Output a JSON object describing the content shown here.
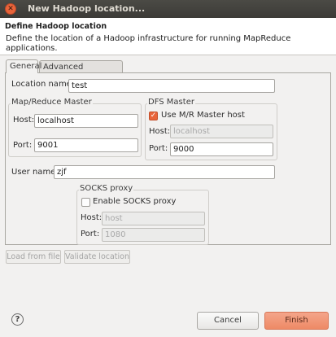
{
  "window": {
    "title": "New Hadoop location..."
  },
  "header": {
    "title": "Define Hadoop location",
    "description": "Define the location of a Hadoop infrastructure for running MapReduce applications."
  },
  "tabs": [
    {
      "label": "General",
      "selected": true
    },
    {
      "label": "Advanced parameters",
      "selected": false
    }
  ],
  "general": {
    "location_name_label": "Location name:",
    "location_name_value": "test",
    "mapreduce_master": {
      "title": "Map/Reduce Master",
      "host_label": "Host:",
      "host_value": "localhost",
      "port_label": "Port:",
      "port_value": "9001"
    },
    "dfs_master": {
      "title": "DFS Master",
      "use_mr_label": "Use M/R Master host",
      "use_mr_checked": true,
      "host_label": "Host:",
      "host_value": "localhost",
      "port_label": "Port:",
      "port_value": "9000"
    },
    "user_name_label": "User name:",
    "user_name_value": "zjf",
    "socks_proxy": {
      "title": "SOCKS proxy",
      "enable_label": "Enable SOCKS proxy",
      "enable_checked": false,
      "host_label": "Host:",
      "host_value": "host",
      "port_label": "Port:",
      "port_value": "1080"
    }
  },
  "actions": {
    "load_from_file": "Load from file",
    "validate_location": "Validate location"
  },
  "footer": {
    "help_glyph": "?",
    "cancel": "Cancel",
    "finish": "Finish"
  },
  "colors": {
    "accent": "#e9643a",
    "finish_bg": "#ee8a66",
    "titlebar": "#3c3b37"
  }
}
